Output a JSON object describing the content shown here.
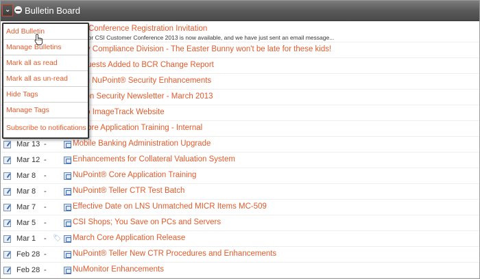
{
  "header": {
    "title": "Bulletin Board"
  },
  "menu": {
    "items": [
      "Add Bulletin",
      "Manage Bulletins",
      "Mark all as read",
      "Mark all as un-read",
      "Hide Tags",
      "Manage Tags",
      "Subscribe to notifications"
    ]
  },
  "bulletins": [
    {
      "date": "",
      "title": "mer Conference Registration Invitation",
      "sub": "bsite for CSI Customer Conference 2013 is now available, and we have just sent an email message..."
    },
    {
      "date": "",
      "title": "atory Compliance Division - The Easter Bunny won't be late for these kids!"
    },
    {
      "date": "",
      "title": "Requests Added to BCR Change Report"
    },
    {
      "date": "",
      "title": "ming NuPoint® Security Enhancements"
    },
    {
      "date": "",
      "title": "nation Security Newsletter - March 2013"
    },
    {
      "date": "",
      "title": "ge to ImageTrack Website"
    },
    {
      "date": "",
      "title": "nt Core Application Training - Internal"
    },
    {
      "date": "Mar 13",
      "title": "Mobile Banking Administration Upgrade"
    },
    {
      "date": "Mar 12",
      "title": "Enhancements for Collateral Valuation System"
    },
    {
      "date": "Mar 8",
      "title": "NuPoint® Core Application Training"
    },
    {
      "date": "Mar 8",
      "title": "NuPoint® Teller CTR Test Batch"
    },
    {
      "date": "Mar 7",
      "title": "Effective Date on LNS Unmatched MICR Items MC-509"
    },
    {
      "date": "Mar 5",
      "title": "CSI Shops; You Save on PCs and Servers"
    },
    {
      "date": "Mar 1",
      "title": "March Core Application Release",
      "tagged": true
    },
    {
      "date": "Feb 28",
      "title": "NuPoint® Teller New CTR Procedures and Enhancements"
    },
    {
      "date": "Feb 28",
      "title": "NuMonitor Enhancements"
    }
  ],
  "dash": "-",
  "icons": {
    "toggle": "chevron-down-icon",
    "minimize": "minus-circle-icon",
    "row": "bulletin-doc-icon",
    "link": "bulletin-link-icon",
    "tag": "tag-icon",
    "cursor": "hand-pointer-icon"
  },
  "colors": {
    "link": "#e05a2b",
    "header": "#5a5a5a",
    "toggle_border": "#d44a2a"
  }
}
